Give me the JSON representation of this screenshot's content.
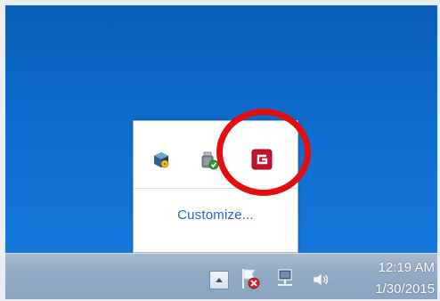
{
  "tray_overflow": {
    "customize_label": "Customize...",
    "icons": [
      "virtualbox-icon",
      "usb-device-icon",
      "g-app-icon"
    ]
  },
  "taskbar": {
    "clock_time": "12:19 AM",
    "clock_date": "1/30/2015",
    "tray_icons": [
      "show-hidden-icons-chevron",
      "action-center-flag-icon",
      "network-icon",
      "volume-icon"
    ]
  },
  "colors": {
    "desktop_blue": "#0e6ccd",
    "highlight_red": "#e30d0d",
    "link_blue": "#1f64c5",
    "g_icon_red": "#c8102e"
  }
}
